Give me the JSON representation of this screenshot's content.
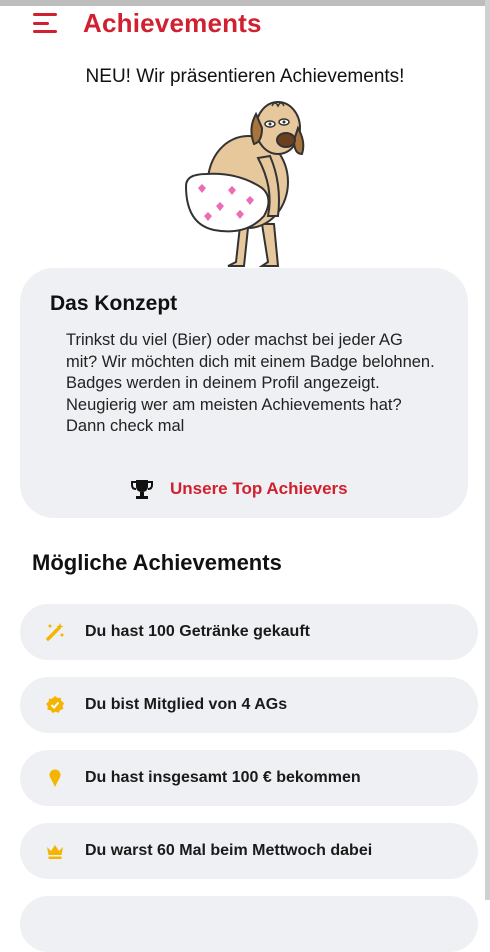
{
  "header": {
    "title": "Achievements",
    "menu_icon": "hamburger-menu-icon"
  },
  "intro": "NEU! Wir präsentieren Achievements!",
  "concept": {
    "title": "Das Konzept",
    "text": "Trinkst du viel (Bier) oder machst bei jeder AG mit? Wir möchten dich mit einem Badge belohnen. Badges werden in deinem Profil angezeigt. Neugierig wer am meisten Achievements hat? Dann check mal",
    "link_label": "Unsere Top Achievers",
    "link_icon": "trophy-icon"
  },
  "achievements_title": "Mögliche Achievements",
  "achievements": [
    {
      "label": "Du hast 100 Getränke gekauft",
      "icon": "magic-wand-icon"
    },
    {
      "label": "Du bist Mitglied von 4 AGs",
      "icon": "verified-badge-icon"
    },
    {
      "label": "Du hast insgesamt 100 € bekommen",
      "icon": "ice-cream-icon"
    },
    {
      "label": "Du warst 60 Mal beim Mettwoch dabei",
      "icon": "crown-icon"
    }
  ],
  "colors": {
    "accent": "#d1202f",
    "card": "#eef0f3",
    "icon": "#f5b400"
  }
}
